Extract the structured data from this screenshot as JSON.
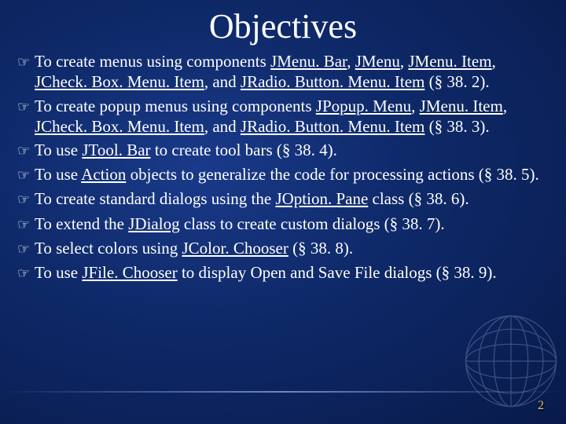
{
  "title": "Objectives",
  "bullet_glyph": "☞",
  "items": [
    {
      "segments": [
        {
          "t": "To create menus using components "
        },
        {
          "t": "JMenu. Bar",
          "u": true
        },
        {
          "t": ", "
        },
        {
          "t": "JMenu",
          "u": true
        },
        {
          "t": ", "
        },
        {
          "t": "JMenu. Item",
          "u": true
        },
        {
          "t": ", "
        },
        {
          "t": "JCheck. Box. Menu. Item",
          "u": true
        },
        {
          "t": ", and "
        },
        {
          "t": "JRadio. Button. Menu. Item",
          "u": true
        },
        {
          "t": " (§ 38. 2)."
        }
      ]
    },
    {
      "segments": [
        {
          "t": "To create popup menus using components "
        },
        {
          "t": "JPopup. Menu",
          "u": true
        },
        {
          "t": ", "
        },
        {
          "t": "JMenu. Item",
          "u": true
        },
        {
          "t": ", "
        },
        {
          "t": "JCheck. Box. Menu. Item",
          "u": true
        },
        {
          "t": ", and "
        },
        {
          "t": "JRadio. Button. Menu. Item",
          "u": true
        },
        {
          "t": " (§ 38. 3)."
        }
      ]
    },
    {
      "segments": [
        {
          "t": "To use "
        },
        {
          "t": "JTool. Bar",
          "u": true
        },
        {
          "t": " to create tool bars (§ 38. 4)."
        }
      ]
    },
    {
      "segments": [
        {
          "t": "To use "
        },
        {
          "t": "Action",
          "u": true
        },
        {
          "t": " objects to generalize the code for processing actions (§ 38. 5)."
        }
      ]
    },
    {
      "segments": [
        {
          "t": "To create standard dialogs using the "
        },
        {
          "t": "JOption. Pane",
          "u": true
        },
        {
          "t": " class (§ 38. 6)."
        }
      ]
    },
    {
      "segments": [
        {
          "t": "To extend the "
        },
        {
          "t": "JDialog",
          "u": true
        },
        {
          "t": " class to create custom dialogs (§ 38. 7)."
        }
      ]
    },
    {
      "segments": [
        {
          "t": "To select colors using "
        },
        {
          "t": "JColor. Chooser",
          "u": true
        },
        {
          "t": " (§ 38. 8)."
        }
      ]
    },
    {
      "segments": [
        {
          "t": "To use "
        },
        {
          "t": "JFile. Chooser",
          "u": true
        },
        {
          "t": " to display Open and Save File dialogs (§ 38. 9)."
        }
      ]
    }
  ],
  "page_number": "2"
}
